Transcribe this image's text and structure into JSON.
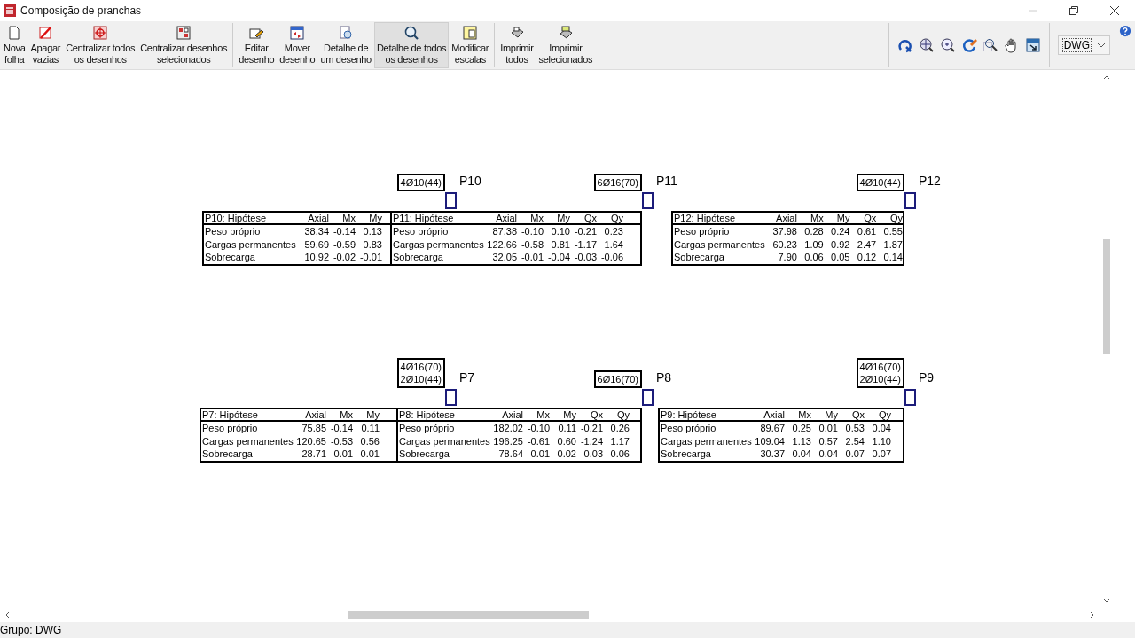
{
  "window": {
    "title": "Composição de pranchas"
  },
  "toolbar": [
    {
      "label": "Nova\nfolha",
      "selected": false
    },
    {
      "label": "Apagar\nvazias",
      "selected": false
    },
    {
      "label": "Centralizar todos\nos desenhos",
      "selected": false
    },
    {
      "label": "Centralizar desenhos\nselecionados",
      "selected": false
    },
    {
      "label": "Editar\ndesenho",
      "selected": false
    },
    {
      "label": "Mover\ndesenho",
      "selected": false
    },
    {
      "label": "Detalhe de\num desenho",
      "selected": false
    },
    {
      "label": "Detalhe de todos\nos desenhos",
      "selected": true
    },
    {
      "label": "Modificar\nescalas",
      "selected": false
    },
    {
      "label": "Imprimir\ntodos",
      "selected": false
    },
    {
      "label": "Imprimir\nselecionados",
      "selected": false
    }
  ],
  "view_select": {
    "value": "DWG"
  },
  "drawings": [
    {
      "pillar": "P10",
      "bars": [
        "4Ø10(44)"
      ],
      "title": "P10: Hipótese",
      "columns": [
        "Axial",
        "Mx",
        "My"
      ],
      "rows": [
        {
          "name": "Peso próprio",
          "values": [
            "38.34",
            "-0.14",
            "0.13"
          ]
        },
        {
          "name": "Cargas permanentes",
          "values": [
            "59.69",
            "-0.59",
            "0.83"
          ]
        },
        {
          "name": "Sobrecarga",
          "values": [
            "10.92",
            "-0.02",
            "-0.01"
          ]
        }
      ]
    },
    {
      "pillar": "P11",
      "bars": [
        "6Ø16(70)"
      ],
      "title": "P11: Hipótese",
      "columns": [
        "Axial",
        "Mx",
        "My",
        "Qx",
        "Qy"
      ],
      "rows": [
        {
          "name": "Peso próprio",
          "values": [
            "87.38",
            "-0.10",
            "0.10",
            "-0.21",
            "0.23"
          ]
        },
        {
          "name": "Cargas permanentes",
          "values": [
            "122.66",
            "-0.58",
            "0.81",
            "-1.17",
            "1.64"
          ]
        },
        {
          "name": "Sobrecarga",
          "values": [
            "32.05",
            "-0.01",
            "-0.04",
            "-0.03",
            "-0.06"
          ]
        }
      ]
    },
    {
      "pillar": "P12",
      "bars": [
        "4Ø10(44)"
      ],
      "title": "P12: Hipótese",
      "columns": [
        "Axial",
        "Mx",
        "My",
        "Qx",
        "Qy"
      ],
      "rows": [
        {
          "name": "Peso próprio",
          "values": [
            "37.98",
            "0.28",
            "0.24",
            "0.61",
            "0.55"
          ]
        },
        {
          "name": "Cargas permanentes",
          "values": [
            "60.23",
            "1.09",
            "0.92",
            "2.47",
            "1.87"
          ]
        },
        {
          "name": "Sobrecarga",
          "values": [
            "7.90",
            "0.06",
            "0.05",
            "0.12",
            "0.14"
          ]
        }
      ]
    },
    {
      "pillar": "P7",
      "bars": [
        "4Ø16(70)",
        "2Ø10(44)"
      ],
      "title": "P7: Hipótese",
      "columns": [
        "Axial",
        "Mx",
        "My"
      ],
      "rows": [
        {
          "name": "Peso próprio",
          "values": [
            "75.85",
            "-0.14",
            "0.11"
          ]
        },
        {
          "name": "Cargas permanentes",
          "values": [
            "120.65",
            "-0.53",
            "0.56"
          ]
        },
        {
          "name": "Sobrecarga",
          "values": [
            "28.71",
            "-0.01",
            "0.01"
          ]
        }
      ]
    },
    {
      "pillar": "P8",
      "bars": [
        "6Ø16(70)"
      ],
      "title": "P8: Hipótese",
      "columns": [
        "Axial",
        "Mx",
        "My",
        "Qx",
        "Qy"
      ],
      "rows": [
        {
          "name": "Peso próprio",
          "values": [
            "182.02",
            "-0.10",
            "0.11",
            "-0.21",
            "0.26"
          ]
        },
        {
          "name": "Cargas permanentes",
          "values": [
            "196.25",
            "-0.61",
            "0.60",
            "-1.24",
            "1.17"
          ]
        },
        {
          "name": "Sobrecarga",
          "values": [
            "78.64",
            "-0.01",
            "0.02",
            "-0.03",
            "0.06"
          ]
        }
      ]
    },
    {
      "pillar": "P9",
      "bars": [
        "4Ø16(70)",
        "2Ø10(44)"
      ],
      "title": "P9: Hipótese",
      "columns": [
        "Axial",
        "Mx",
        "My",
        "Qx",
        "Qy"
      ],
      "rows": [
        {
          "name": "Peso próprio",
          "values": [
            "89.67",
            "0.25",
            "0.01",
            "0.53",
            "0.04"
          ]
        },
        {
          "name": "Cargas permanentes",
          "values": [
            "109.04",
            "1.13",
            "0.57",
            "2.54",
            "1.10"
          ]
        },
        {
          "name": "Sobrecarga",
          "values": [
            "30.37",
            "0.04",
            "-0.04",
            "0.07",
            "-0.07"
          ]
        }
      ]
    }
  ],
  "status_bar": "Grupo: DWG"
}
